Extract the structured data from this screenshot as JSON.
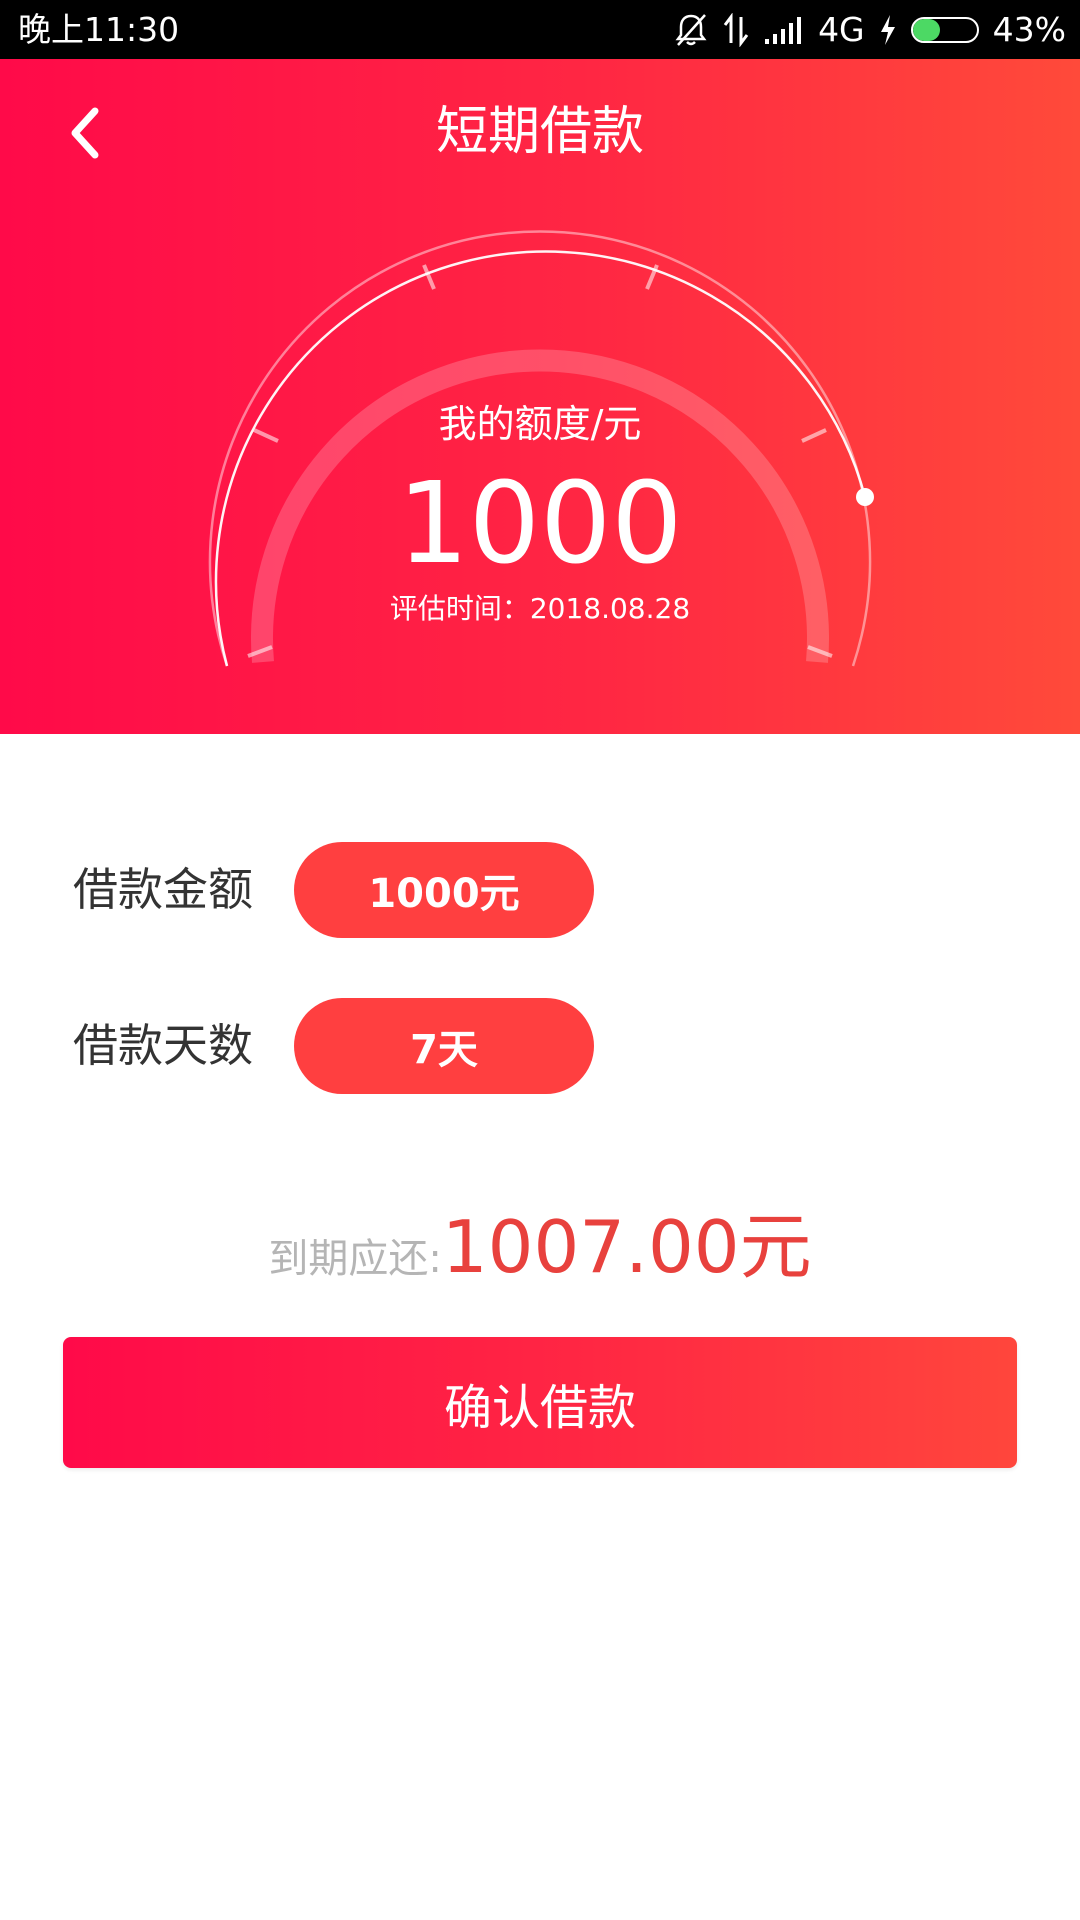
{
  "status_bar": {
    "time": "晚上11:30",
    "network": "4G",
    "battery_percent": "43%",
    "battery_level": 0.43,
    "battery_color": "#4cd964",
    "icons": [
      "bell-muted-icon",
      "data-arrows-icon",
      "signal-icon",
      "charging-bolt-icon",
      "battery-icon"
    ]
  },
  "header": {
    "back_icon": "chevron-left-icon",
    "title": "短期借款"
  },
  "quota": {
    "label": "我的额度/元",
    "value": "1000",
    "eval_time": "评估时间：2018.08.28"
  },
  "loan_amount": {
    "label": "借款金额",
    "value": "1000元"
  },
  "loan_days": {
    "label": "借款天数",
    "value": "7天"
  },
  "due": {
    "label": "到期应还:",
    "amount": "1007.00元"
  },
  "confirm_button": {
    "label": "确认借款"
  },
  "colors": {
    "gradient_start": "#ff0a49",
    "gradient_end": "#ff4a3a",
    "pill": "#ff3f40",
    "due_amount": "#e8413d",
    "due_label": "#b5b5b5"
  }
}
